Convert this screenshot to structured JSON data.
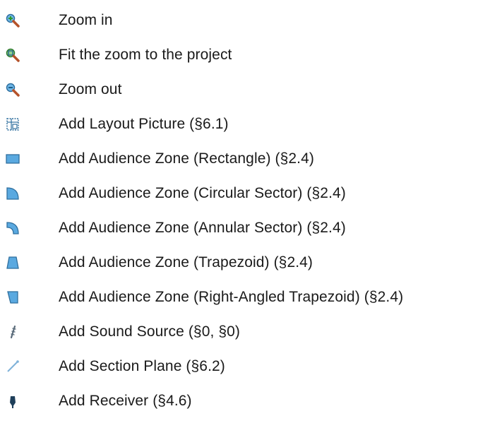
{
  "legend": {
    "items": [
      {
        "icon": "zoom-in-icon",
        "label": "Zoom in"
      },
      {
        "icon": "zoom-fit-icon",
        "label": "Fit the zoom to the project"
      },
      {
        "icon": "zoom-out-icon",
        "label": "Zoom out"
      },
      {
        "icon": "layout-picture-icon",
        "label": "Add Layout Picture (§6.1)"
      },
      {
        "icon": "rectangle-zone-icon",
        "label": "Add Audience Zone (Rectangle) (§2.4)"
      },
      {
        "icon": "circular-sector-zone-icon",
        "label": "Add Audience Zone (Circular Sector) (§2.4)"
      },
      {
        "icon": "annular-sector-zone-icon",
        "label": "Add Audience Zone (Annular Sector) (§2.4)"
      },
      {
        "icon": "trapezoid-zone-icon",
        "label": "Add Audience Zone (Trapezoid) (§2.4)"
      },
      {
        "icon": "right-angled-trapezoid-zone-icon",
        "label": "Add Audience Zone (Right-Angled Trapezoid) (§2.4)"
      },
      {
        "icon": "sound-source-icon",
        "label": "Add Sound Source (§0, §0)"
      },
      {
        "icon": "section-plane-icon",
        "label": "Add Section Plane (§6.2)"
      },
      {
        "icon": "receiver-icon",
        "label": "Add Receiver (§4.6)"
      }
    ]
  },
  "colors": {
    "zone_fill": "#5aa9e0",
    "zone_stroke": "#2f6f9e",
    "magnifier_lens": "#6fb7e8",
    "magnifier_handle": "#b5522a",
    "plus_green": "#2e9a2e",
    "minus_dark": "#1f5f8a",
    "receiver": "#1e3f5a",
    "text": "#1a1a1a"
  }
}
